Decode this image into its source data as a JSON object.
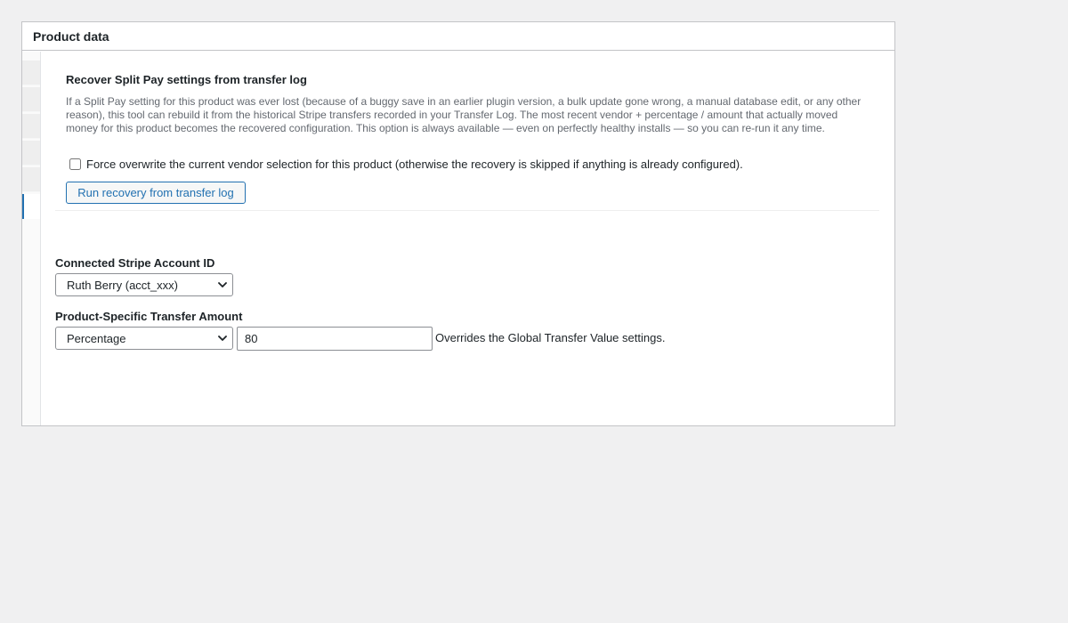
{
  "metabox": {
    "title": "Product data"
  },
  "recovery": {
    "heading": "Recover Split Pay settings from transfer log",
    "description": "If a Split Pay setting for this product was ever lost (because of a buggy save in an earlier plugin version, a bulk update gone wrong, a manual database edit, or any other reason), this tool can rebuild it from the historical Stripe transfers recorded in your Transfer Log. The most recent vendor + percentage / amount that actually moved money for this product becomes the recovered configuration. This option is always available — even on perfectly healthy installs — so you can re-run it any time.",
    "force_checkbox_label": "Force overwrite the current vendor selection for this product (otherwise the recovery is skipped if anything is already configured).",
    "force_checked": false,
    "run_button_label": "Run recovery from transfer log"
  },
  "stripe_account": {
    "label": "Connected Stripe Account ID",
    "selected": "Ruth Berry (acct_xxx)"
  },
  "transfer_amount": {
    "label": "Product-Specific Transfer Amount",
    "type_selected": "Percentage",
    "value": "80",
    "hint": "Overrides the Global Transfer Value settings."
  },
  "colors": {
    "accent": "#2271b1",
    "page_background": "#f0f0f1",
    "border": "#c3c4c7",
    "muted_text": "#646970"
  },
  "icons": {
    "select_arrow": "chevron-down-icon"
  }
}
